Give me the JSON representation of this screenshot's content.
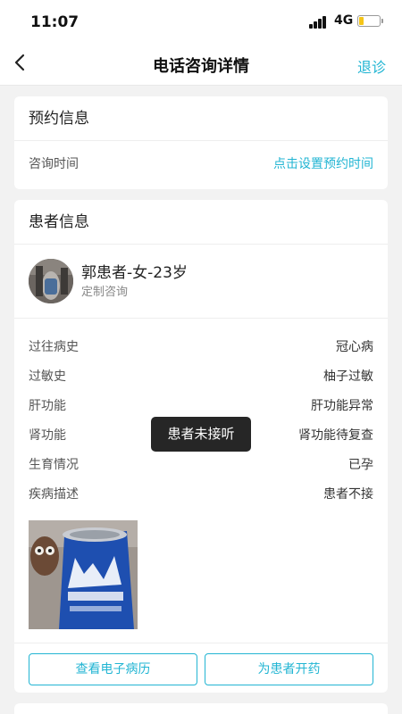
{
  "status_bar": {
    "time": "11:07",
    "network": "4G"
  },
  "nav": {
    "title": "电话咨询详情",
    "action": "退诊"
  },
  "appointment": {
    "header": "预约信息",
    "time_label": "咨询时间",
    "time_value": "点击设置预约时间"
  },
  "patient": {
    "header": "患者信息",
    "name": "郭患者-女-23岁",
    "type": "定制咨询",
    "details": [
      {
        "label": "过往病史",
        "value": "冠心病"
      },
      {
        "label": "过敏史",
        "value": "柚子过敏"
      },
      {
        "label": "肝功能",
        "value": "肝功能异常"
      },
      {
        "label": "肾功能",
        "value": "肾功能待复查"
      },
      {
        "label": "生育情况",
        "value": "已孕"
      },
      {
        "label": "疾病描述",
        "value": "患者不接"
      }
    ],
    "buttons": {
      "emr": "查看电子病历",
      "prescribe": "为患者开药"
    }
  },
  "toast": "患者未接听",
  "colors": {
    "accent": "#22b5d3",
    "background": "#f2f2f2"
  }
}
